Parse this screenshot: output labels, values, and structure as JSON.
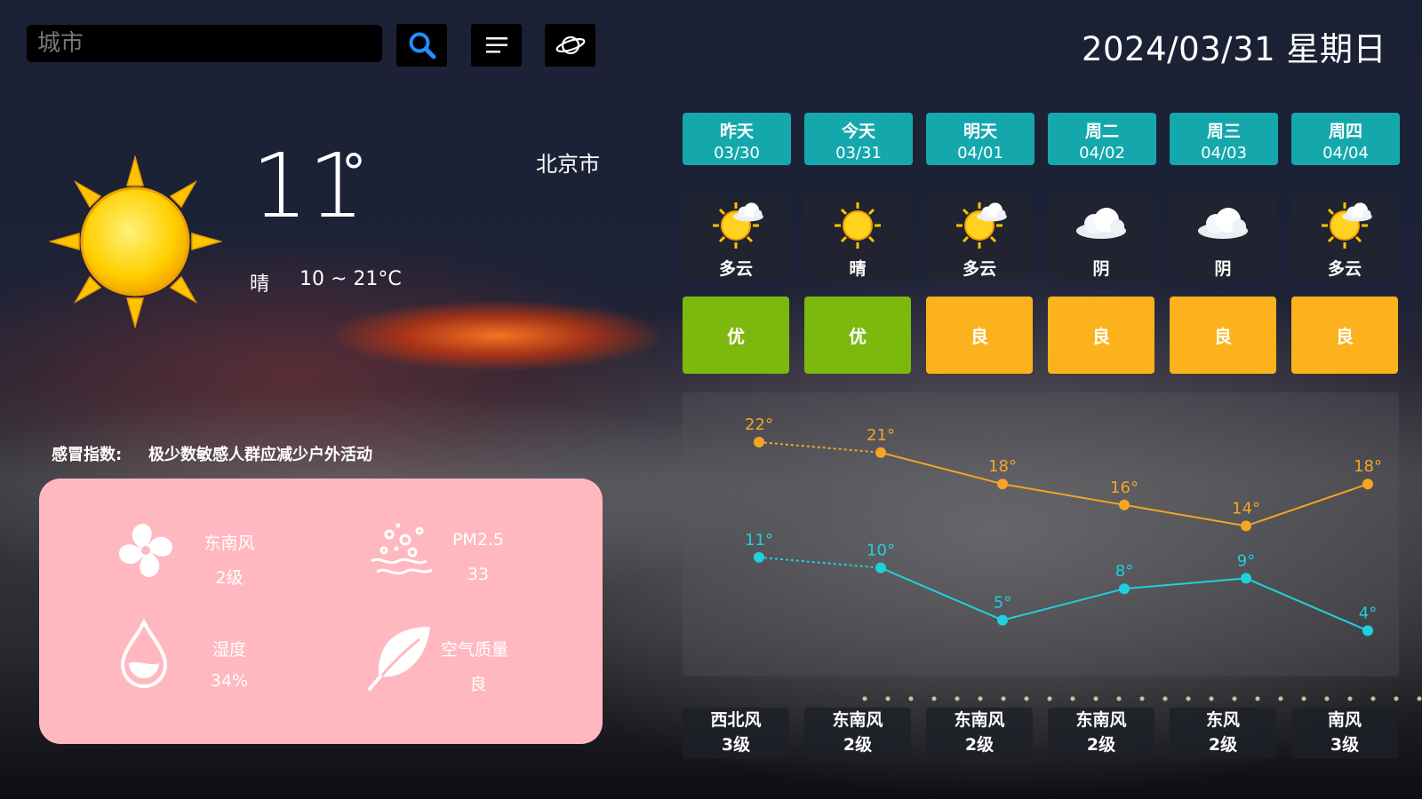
{
  "search": {
    "placeholder": "城市"
  },
  "date_text": "2024/03/31 星期日",
  "current": {
    "city": "北京市",
    "temp": "11",
    "deg": "°",
    "condition": "晴",
    "range": "10 ~ 21°C",
    "icon": "sun-icon",
    "cold_label": "感冒指数:",
    "cold_text": "极少数敏感人群应减少户外活动"
  },
  "info": {
    "wind": {
      "label": "东南风",
      "value": "2级",
      "icon": "fan-icon"
    },
    "pm": {
      "label": "PM2.5",
      "value": "33",
      "icon": "particles-icon"
    },
    "humidity": {
      "label": "湿度",
      "value": "34%",
      "icon": "droplet-icon"
    },
    "air": {
      "label": "空气质量",
      "value": "良",
      "icon": "leaf-icon"
    }
  },
  "colors": {
    "tab": "#14a8ad",
    "aqi_good": "#7cb80e",
    "aqi_moderate": "#fbb21c",
    "card_pink": "#ffb8c0",
    "high_line": "#f5a623",
    "low_line": "#1fd1dc"
  },
  "days": [
    {
      "name": "昨天",
      "date": "03/30",
      "weather": "多云",
      "icon": "partly-cloudy-icon",
      "aqi": "优",
      "aqi_level": "good",
      "wind_dir": "西北风",
      "wind_level": "3级"
    },
    {
      "name": "今天",
      "date": "03/31",
      "weather": "晴",
      "icon": "sun-icon",
      "aqi": "优",
      "aqi_level": "good",
      "wind_dir": "东南风",
      "wind_level": "2级"
    },
    {
      "name": "明天",
      "date": "04/01",
      "weather": "多云",
      "icon": "partly-cloudy-icon",
      "aqi": "良",
      "aqi_level": "moderate",
      "wind_dir": "东南风",
      "wind_level": "2级"
    },
    {
      "name": "周二",
      "date": "04/02",
      "weather": "阴",
      "icon": "cloud-icon",
      "aqi": "良",
      "aqi_level": "moderate",
      "wind_dir": "东南风",
      "wind_level": "2级"
    },
    {
      "name": "周三",
      "date": "04/03",
      "weather": "阴",
      "icon": "cloud-icon",
      "aqi": "良",
      "aqi_level": "moderate",
      "wind_dir": "东风",
      "wind_level": "2级"
    },
    {
      "name": "周四",
      "date": "04/04",
      "weather": "多云",
      "icon": "partly-cloudy-icon",
      "aqi": "良",
      "aqi_level": "moderate",
      "wind_dir": "南风",
      "wind_level": "3级"
    }
  ],
  "chart_data": {
    "type": "line",
    "categories": [
      "03/30",
      "03/31",
      "04/01",
      "04/02",
      "04/03",
      "04/04"
    ],
    "series": [
      {
        "values": [
          22,
          21,
          18,
          16,
          14,
          18
        ]
      },
      {
        "values": [
          11,
          10,
          5,
          8,
          9,
          4
        ]
      }
    ],
    "label_suffix": "°",
    "grid": false
  }
}
